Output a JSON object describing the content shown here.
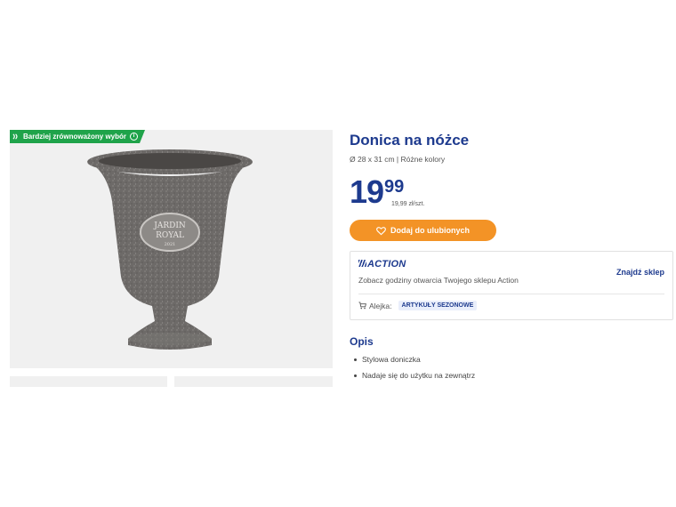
{
  "badge": {
    "label": "Bardziej zrównoważony wybór",
    "info": "i"
  },
  "product": {
    "title": "Donica na nóżce",
    "subtitle": "Ø 28 x 31 cm | Różne kolory",
    "price_int": "19",
    "price_dec": "99",
    "unit_price": "19,99 zł/szt.",
    "image_text": {
      "line1": "JARDIN",
      "line2": "ROYAL",
      "line3": "2021"
    }
  },
  "favorite": {
    "label": "Dodaj do ulubionych"
  },
  "store": {
    "logo": "ACTION",
    "find_label": "Znajdź sklep",
    "hours_text": "Zobacz godziny otwarcia Twojego sklepu Action",
    "aisle_label": "Alejka:",
    "aisle_value": "ARTYKUŁY SEZONOWE"
  },
  "description": {
    "title": "Opis",
    "items": [
      "Stylowa doniczka",
      "Nadaje się do użytku na zewnątrz"
    ]
  },
  "colors": {
    "brand_blue": "#1d3a8e",
    "orange": "#f39326",
    "green": "#1fa34a"
  }
}
